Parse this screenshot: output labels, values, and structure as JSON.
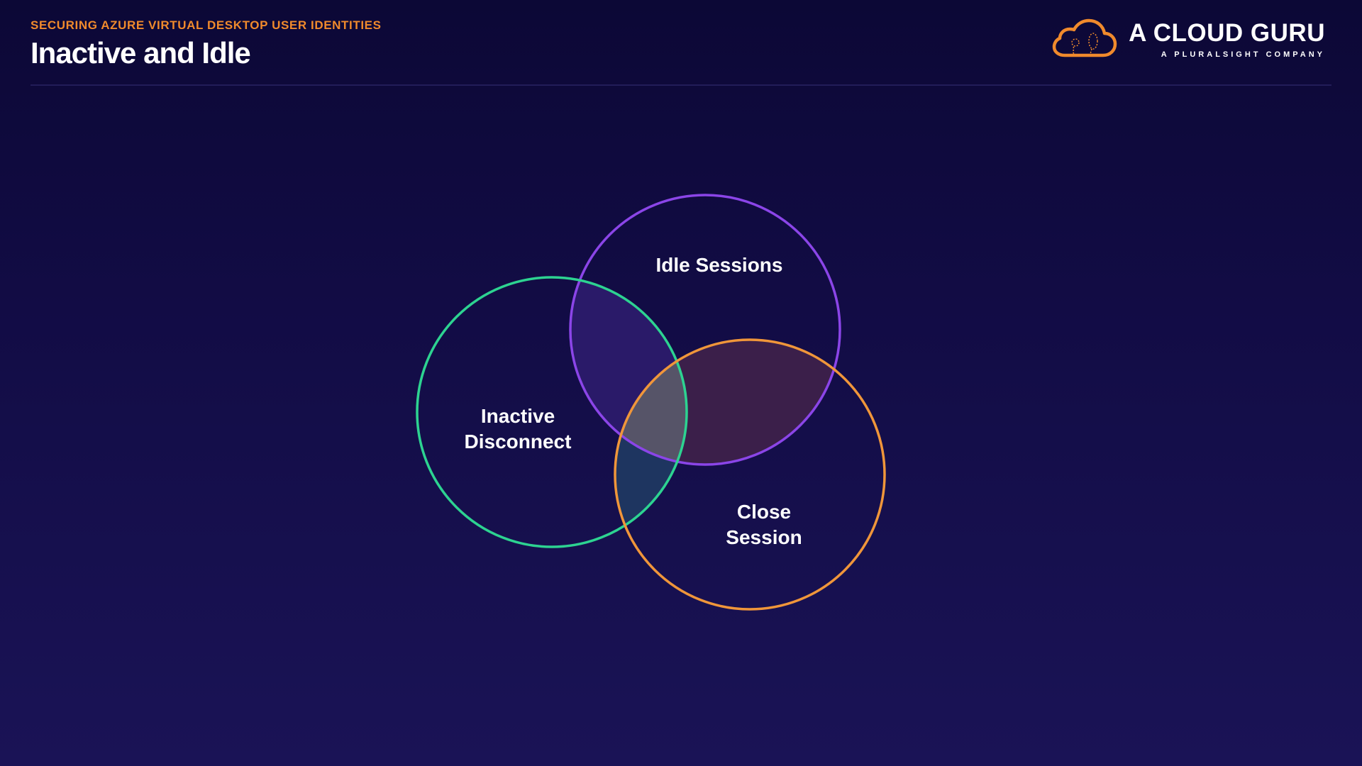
{
  "header": {
    "eyebrow": "SECURING AZURE VIRTUAL DESKTOP USER IDENTITIES",
    "title": "Inactive and Idle"
  },
  "brand": {
    "name": "A CLOUD GURU",
    "tagline": "A PLURALSIGHT COMPANY",
    "logo_icon": "cloud-logo-icon",
    "accent_color": "#f08a2c"
  },
  "venn": {
    "circles": [
      {
        "label": "Idle Sessions",
        "color": "#8b45e8"
      },
      {
        "label": "Inactive\nDisconnect",
        "color": "#2dd391"
      },
      {
        "label": "Close\nSession",
        "color": "#f0963a"
      }
    ],
    "overlap_colors": {
      "idle_inactive": "#2a1a69",
      "idle_close": "#3b1f4a",
      "inactive_close": "#1e3560",
      "all": "#565468"
    }
  },
  "colors": {
    "background_top": "#0c0836",
    "background_bottom": "#1a1356",
    "title_text": "#ffffff"
  }
}
